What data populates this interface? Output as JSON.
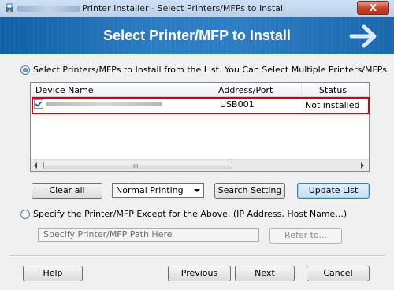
{
  "window": {
    "title": "Printer Installer - Select Printers/MFPs to Install",
    "close_label": "X"
  },
  "banner": {
    "title": "Select Printer/MFP to Install"
  },
  "option_list": {
    "label": "Select Printers/MFPs to Install from the List. You Can Select Multiple Printers/MFPs.",
    "selected": true
  },
  "table": {
    "columns": [
      "Device Name",
      "Address/Port",
      "Status"
    ],
    "rows": [
      {
        "device_name": "",
        "address_port": "USB001",
        "status": "Not installed",
        "checked": true
      }
    ],
    "scroll_grip": "III"
  },
  "controls": {
    "clear_all": "Clear all",
    "printing_mode": "Normal Printing",
    "search_setting": "Search Setting",
    "update_list": "Update List"
  },
  "option_specify": {
    "label": "Specify the Printer/MFP Except for the Above. (IP Address, Host Name...)",
    "selected": false,
    "path_placeholder": "Specify Printer/MFP Path Here",
    "refer_to": "Refer to..."
  },
  "footer": {
    "help": "Help",
    "previous": "Previous",
    "next": "Next",
    "cancel": "Cancel"
  },
  "colors": {
    "banner": "#2d7cc4",
    "highlight": "#d7000f",
    "close": "#c7452b"
  }
}
